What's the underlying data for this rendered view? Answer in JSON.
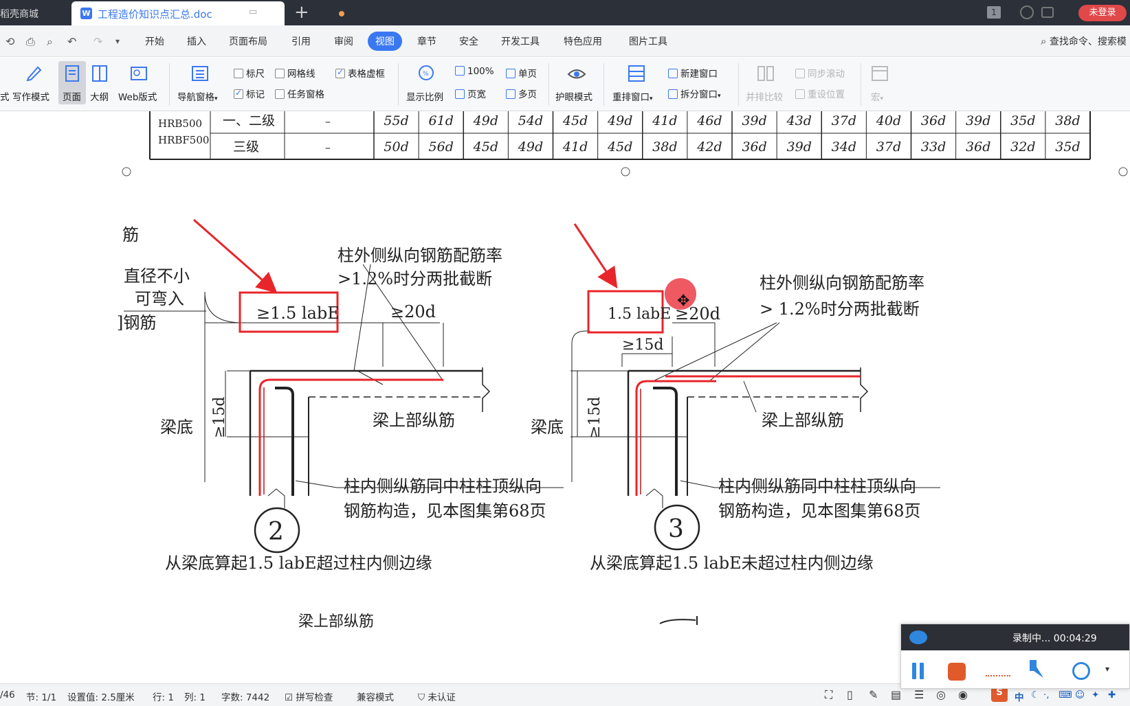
{
  "tabs": {
    "inactive_label": "稻壳商城",
    "active_label": "工程造价知识点汇总.doc",
    "active_icon": "W",
    "new_tab": "+"
  },
  "window_controls": {
    "page_count": "1",
    "login": "未登录"
  },
  "menu": {
    "items": [
      "开始",
      "插入",
      "页面布局",
      "引用",
      "审阅",
      "视图",
      "章节",
      "安全",
      "开发工具",
      "特色应用",
      "图片工具"
    ],
    "active": "视图",
    "search": "查找命令、搜索模"
  },
  "ribbon": {
    "mode_cut": "式",
    "write_mode": "写作模式",
    "page": "页面",
    "outline": "大纲",
    "web": "Web版式",
    "nav_pane": "导航窗格",
    "ruler": "标尺",
    "gridlines": "网格线",
    "table_border": "表格虚框",
    "marks": "标记",
    "task_pane": "任务窗格",
    "zoom": "显示比例",
    "zoom_100": "100%",
    "single_page": "单页",
    "page_width": "页宽",
    "multi_page": "多页",
    "eye_mode": "护眼模式",
    "rearrange": "重排窗口",
    "new_window": "新建窗口",
    "split_window": "拆分窗口",
    "side_by_side": "并排比较",
    "sync_scroll": "同步滚动",
    "reset_pos": "重设位置",
    "macro": "宏"
  },
  "doc": {
    "table": {
      "grade_col": [
        "HRB500",
        "HRBF500"
      ],
      "rows": [
        {
          "level": "一、二级",
          "dash": "–",
          "values": [
            "55d",
            "61d",
            "49d",
            "54d",
            "45d",
            "49d",
            "41d",
            "46d",
            "39d",
            "43d",
            "37d",
            "40d",
            "36d",
            "39d",
            "35d",
            "38d"
          ]
        },
        {
          "level": "三级",
          "dash": "–",
          "values": [
            "50d",
            "56d",
            "45d",
            "49d",
            "41d",
            "45d",
            "38d",
            "42d",
            "36d",
            "39d",
            "34d",
            "37d",
            "33d",
            "36d",
            "32d",
            "35d"
          ]
        }
      ]
    },
    "left_cut": [
      "筋",
      "直径不小",
      "可弯入",
      "]钢筋"
    ],
    "fig2": {
      "ratio_note_1": "柱外侧纵向钢筋配筋率",
      "ratio_note_2": ">1.2%时分两批截断",
      "dim_box": "≥1.5 labE",
      "dim_20d": "≥20d",
      "dim_15d": "≥15d",
      "beam_bottom": "梁底",
      "top_bar": "梁上部纵筋",
      "inner_1": "柱内侧纵筋同中柱柱顶纵向",
      "inner_2": "钢筋构造，见本图集第68页",
      "number": "2",
      "caption": "从梁底算起1.5 labE超过柱内侧边缘"
    },
    "fig3": {
      "ratio_note_1": "柱外侧纵向钢筋配筋率",
      "ratio_note_2": "> 1.2%时分两批截断",
      "dim_box": "1.5 labE",
      "dim_20d": "≥20d",
      "dim_15d_top": "≥15d",
      "dim_15d": "≥15d",
      "beam_bottom": "梁底",
      "top_bar": "梁上部纵筋",
      "inner_1": "柱内侧纵筋同中柱柱顶纵向",
      "inner_2": "钢筋构造，见本图集第68页",
      "number": "3",
      "caption": "从梁底算起1.5 labE未超过柱内侧边缘"
    },
    "bottom_text": "梁上部纵筋"
  },
  "status": {
    "page": "/46",
    "section": "节: 1/1",
    "setting": "设置值: 2.5厘米",
    "row": "行: 1",
    "col": "列: 1",
    "words": "字数: 7442",
    "spell": "拼写检查",
    "compat": "兼容模式",
    "cert": "未认证"
  },
  "recorder": {
    "status": "录制中... 00:04:29"
  },
  "colors": {
    "accent": "#3a78f2",
    "rebar_red": "#e8252a",
    "login_red": "#e0484a",
    "tabbar": "#2b3039"
  }
}
